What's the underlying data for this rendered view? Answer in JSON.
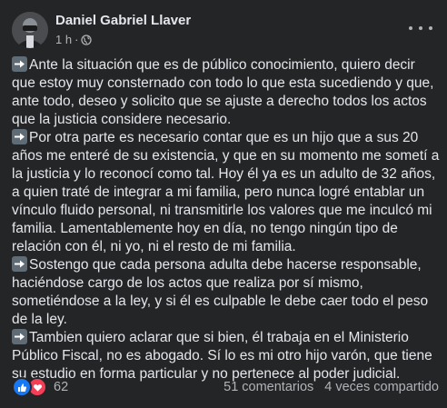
{
  "author": {
    "name": "Daniel Gabriel Llaver",
    "time": "1 h",
    "separator": "·"
  },
  "icons": {
    "avatar": "profile-photo",
    "audience": "globe-icon",
    "more": "more-options-icon",
    "bullet": "right-arrow-emoji",
    "like": "like-icon",
    "love": "love-icon"
  },
  "paragraphs": [
    "Ante la situación que es de público conocimiento, quiero decir que estoy muy consternado con todo lo que esta sucediendo y que, ante todo, deseo y solicito que se ajuste a derecho todos los actos que la justicia considere necesario.",
    "Por otra parte es necesario contar que es un hijo que a sus 20 años me enteré de su existencia, y que en su momento me sometí a la justicia y lo reconocí como tal. Hoy él ya es un adulto de 32 años, a quien traté de integrar a mi familia, pero nunca logré entablar un vínculo fluido personal, ni transmitirle los valores que me inculcó mi familia. Lamentablemente hoy en día, no tengo ningún tipo de relación con él, ni yo, ni el resto de mi familia.",
    "Sostengo que cada persona adulta debe hacerse responsable, haciéndose cargo de los actos que realiza por sí  mismo, sometiéndose a la ley, y si él es culpable le debe caer todo el peso de la ley.",
    "Tambien quiero aclarar que si bien, él trabaja en el Ministerio Público Fiscal, no es abogado. Sí lo es mi otro hijo varón, que tiene su estudio en forma particular y no pertenece al poder judicial."
  ],
  "footer": {
    "reactions_count": "62",
    "comments": "51 comentarios",
    "shares": "4 veces compartido"
  },
  "colors": {
    "background": "#242526",
    "text": "#e4e6eb",
    "secondary_text": "#b0b3b8",
    "like_blue": "#1877f2",
    "love_red": "#f33e58"
  }
}
